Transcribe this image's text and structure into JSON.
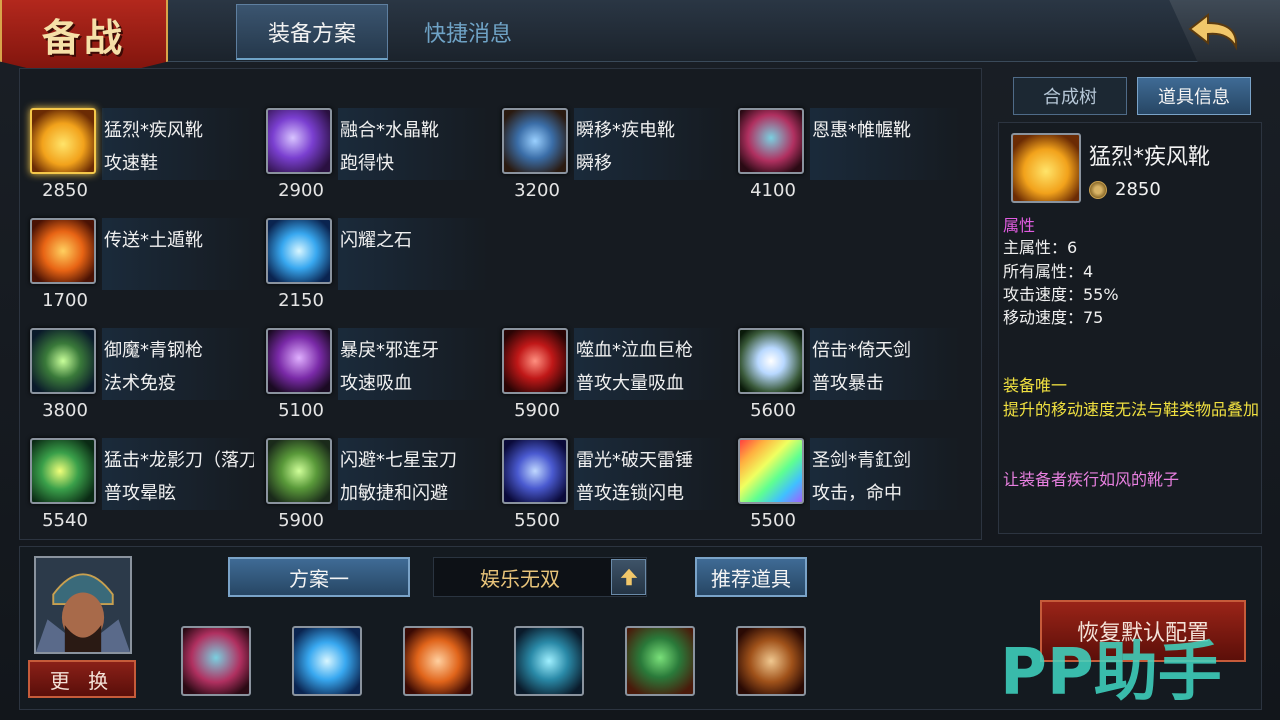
{
  "header": {
    "banner": "备战",
    "tabs": [
      {
        "label": "装备方案",
        "active": true
      },
      {
        "label": "快捷消息",
        "active": false
      }
    ]
  },
  "items": [
    {
      "name": "猛烈*疾风靴",
      "desc": "攻速鞋",
      "price": "2850",
      "icon": "gold-boots-icon",
      "selected": true
    },
    {
      "name": "融合*水晶靴",
      "desc": "跑得快",
      "price": "2900",
      "icon": "purple-boots-icon"
    },
    {
      "name": "瞬移*疾电靴",
      "desc": "瞬移",
      "price": "3200",
      "icon": "blue-boots-icon"
    },
    {
      "name": "恩惠*帷幄靴",
      "desc": "",
      "price": "4100",
      "icon": "teal-boots-icon"
    },
    {
      "name": "传送*土遁靴",
      "desc": "",
      "price": "1700",
      "icon": "fire-boots-icon"
    },
    {
      "name": "闪耀之石",
      "desc": "",
      "price": "2150",
      "icon": "blue-gem-icon"
    },
    {
      "name": "御魔*青钢枪",
      "desc": "法术免疫",
      "price": "3800",
      "icon": "green-spear-icon"
    },
    {
      "name": "暴戾*邪连牙",
      "desc": "攻速吸血",
      "price": "5100",
      "icon": "purple-claw-icon"
    },
    {
      "name": "噬血*泣血巨枪",
      "desc": "普攻大量吸血",
      "price": "5900",
      "icon": "red-spear-icon"
    },
    {
      "name": "倍击*倚天剑",
      "desc": "普攻暴击",
      "price": "5600",
      "icon": "light-sword-icon"
    },
    {
      "name": "猛击*龙影刀（落刀式",
      "desc": "普攻晕眩",
      "price": "5540",
      "icon": "green-blade-icon"
    },
    {
      "name": "闪避*七星宝刀",
      "desc": "加敏捷和闪避",
      "price": "5900",
      "icon": "green-dagger-icon"
    },
    {
      "name": "雷光*破天雷锤",
      "desc": "普攻连锁闪电",
      "price": "5500",
      "icon": "blue-hammer-icon"
    },
    {
      "name": "圣剑*青釭剑",
      "desc": "攻击，命中",
      "price": "5500",
      "icon": "rainbow-sword-icon"
    }
  ],
  "right_tabs": [
    {
      "label": "合成树",
      "active": false
    },
    {
      "label": "道具信息",
      "active": true
    }
  ],
  "detail": {
    "name": "猛烈*疾风靴",
    "price": "2850",
    "attr_heading": "属性",
    "attrs": [
      "主属性：6",
      "所有属性：4",
      "攻击速度：55%",
      "移动速度：75"
    ],
    "unique_title": "装备唯一",
    "unique_desc": "提升的移动速度无法与鞋类物品叠加",
    "flavor": "让装备者疾行如风的靴子",
    "colors": {
      "heading": "#e05ce0",
      "unique": "#f0e040",
      "flavor": "#e880e0"
    }
  },
  "bottom": {
    "swap_label": "更 换",
    "plan_label": "方案一",
    "mode_label": "娱乐无双",
    "recommend_label": "推荐道具",
    "reset_label": "恢复默认配置",
    "slots": [
      "teal-boots-icon",
      "blue-gem-icon",
      "fire-claw-icon",
      "teal-armor-icon",
      "green-block-icon",
      "gold-shield-icon"
    ]
  },
  "watermark": "PP助手"
}
